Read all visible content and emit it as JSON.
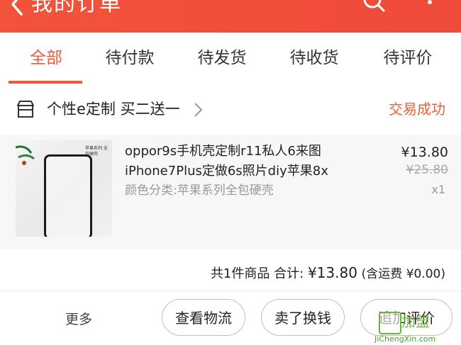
{
  "header": {
    "title": "我的订单",
    "bg_color": "#f04a3a"
  },
  "tabs": [
    {
      "label": "全部",
      "active": true
    },
    {
      "label": "待付款",
      "active": false
    },
    {
      "label": "待发货",
      "active": false
    },
    {
      "label": "待收货",
      "active": false
    },
    {
      "label": "待评价",
      "active": false
    }
  ],
  "order": {
    "shop_name": "个性e定制 买二送一",
    "status": "交易成功",
    "status_color": "#e8623a",
    "product": {
      "title": "oppor9s手机壳定制r11私人6来图iPhone7Plus定做6s照片diy苹果8x",
      "variant": "颜色分类:苹果系列全包硬壳",
      "thumb_caption": "苹果系列 全包硬壳",
      "price": "¥13.80",
      "original_price": "¥25.80",
      "quantity": "x1"
    },
    "summary": {
      "count_text": "共1件商品",
      "total_label": "合计:",
      "total_amount": "¥13.80",
      "shipping_text": "(含运费 ¥0.00)"
    },
    "actions": {
      "more_label": "更多",
      "logistics_label": "查看物流",
      "resell_label": "卖了换钱",
      "review_label": "追加评价"
    }
  },
  "watermark": {
    "text": "加盟",
    "url": "JiChengXin.com"
  }
}
